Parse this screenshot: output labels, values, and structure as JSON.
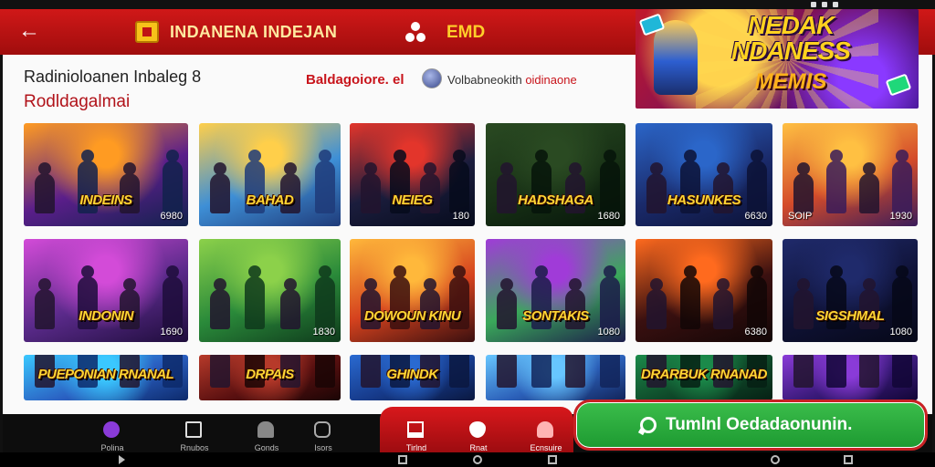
{
  "app_bar": {
    "brand": "INDANENA INDEJAN",
    "center_label": "EMD"
  },
  "page": {
    "title": "Radinioloanen Inbaleg 8",
    "subtitle": "Rodldagalmai",
    "promo": "Baldagoiore. el",
    "channel_name": "Volbabneokith",
    "channel_suffix": "oidinaone"
  },
  "banner": {
    "line1": "NEDAK NDANESS",
    "line2": "MEMIS"
  },
  "games": [
    {
      "title": "INDEINS",
      "count": "6980",
      "tag": "",
      "colors": [
        "#ff9b22",
        "#5a1e8a",
        "#12224d"
      ]
    },
    {
      "title": "BAHAD",
      "count": "",
      "tag": "",
      "colors": [
        "#ffcf4a",
        "#3e8fd6",
        "#1f3b7a"
      ]
    },
    {
      "title": "NEIEG",
      "count": "180",
      "tag": "",
      "colors": [
        "#e3352b",
        "#1b1d3d",
        "#060b1c"
      ]
    },
    {
      "title": "HADSHAGA",
      "count": "1680",
      "tag": "",
      "colors": [
        "#2a4a22",
        "#173015",
        "#06140a"
      ]
    },
    {
      "title": "HASUNKES",
      "count": "6630",
      "tag": "",
      "colors": [
        "#2b66c9",
        "#1a2a6a",
        "#0c1236"
      ]
    },
    {
      "title": "",
      "count": "1930",
      "tag": "SOIP",
      "colors": [
        "#ffc042",
        "#d44b2a",
        "#3a1c5a"
      ]
    },
    {
      "title": "INDONIN",
      "count": "1690",
      "tag": "",
      "colors": [
        "#d34bd8",
        "#5a2a8a",
        "#1e0d3b"
      ]
    },
    {
      "title": "",
      "count": "1830",
      "tag": "",
      "colors": [
        "#8cd14a",
        "#2a8a3a",
        "#0f3a1c"
      ]
    },
    {
      "title": "DOWOUN KINU",
      "count": "",
      "tag": "",
      "colors": [
        "#ffb83b",
        "#d5421e",
        "#3a0f0f"
      ]
    },
    {
      "title": "SONTAKIS",
      "count": "1080",
      "tag": "",
      "colors": [
        "#a03bd8",
        "#3aa85a",
        "#1c1c4a"
      ]
    },
    {
      "title": "",
      "count": "6380",
      "tag": "",
      "colors": [
        "#ff6a1e",
        "#3a1010",
        "#120606"
      ]
    },
    {
      "title": "SIGSHMAL",
      "count": "1080",
      "tag": "",
      "colors": [
        "#1f2a6b",
        "#0f1236",
        "#060818"
      ]
    },
    {
      "title": "PUEPONIAN RNANAL",
      "count": "",
      "tag": "",
      "colors": [
        "#3ac8ff",
        "#2a5fc1",
        "#0d2a6b"
      ]
    },
    {
      "title": "DRPAIS",
      "count": "",
      "tag": "",
      "colors": [
        "#b73a2a",
        "#5a1010",
        "#1a0505"
      ]
    },
    {
      "title": "GHINDK",
      "count": "",
      "tag": "",
      "colors": [
        "#2a6ad1",
        "#163a8a",
        "#0a1840"
      ]
    },
    {
      "title": "",
      "count": "",
      "tag": "",
      "colors": [
        "#67c6ff",
        "#2b5fb8",
        "#12245a"
      ]
    },
    {
      "title": "DRARBUK RNANADE",
      "count": "",
      "tag": "",
      "colors": [
        "#1b8a4a",
        "#0f4a2a",
        "#062014"
      ]
    },
    {
      "title": "",
      "count": "",
      "tag": "",
      "colors": [
        "#8a3bd8",
        "#3a1a7a",
        "#120636"
      ]
    }
  ],
  "nav": {
    "items": [
      {
        "label": "Polina",
        "icon": "circle-icon"
      },
      {
        "label": "Rnubos",
        "icon": "home-icon"
      },
      {
        "label": "Gonds",
        "icon": "people-icon"
      },
      {
        "label": "Isors",
        "icon": "chat-icon"
      },
      {
        "label": "Tirlnd",
        "icon": "bookmark-icon"
      },
      {
        "label": "Rnat",
        "icon": "shield-icon"
      },
      {
        "label": "Ecnsuire",
        "icon": "user-icon"
      }
    ]
  },
  "cta": {
    "label": "Tumlnl Oedadaonunin."
  },
  "colors": {
    "app_bar": "#c81414",
    "cta_green": "#27a83a",
    "accent_red": "#c8141b"
  }
}
